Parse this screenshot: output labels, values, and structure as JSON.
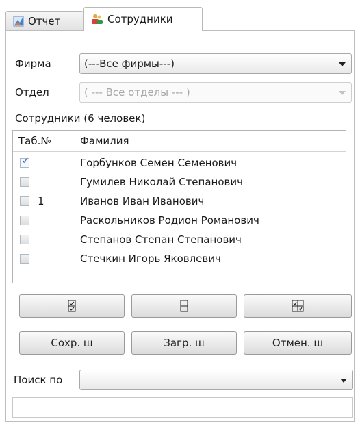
{
  "tabs": [
    {
      "label": "Отчет",
      "icon": "chart-icon"
    },
    {
      "label": "Сотрудники",
      "icon": "people-icon"
    }
  ],
  "filters": {
    "firm_label": "Фирма",
    "firm_value": "(---Все фирмы---)",
    "dept_label": "Отдел",
    "dept_value": "( --- Все отделы --- )"
  },
  "employees": {
    "title": "Сотрудники (6 человек)",
    "columns": [
      "Таб.№",
      "Фамилия"
    ],
    "rows": [
      {
        "checked": true,
        "tab_no": "",
        "name": "Горбунков Семен Семенович"
      },
      {
        "checked": false,
        "tab_no": "",
        "name": "Гумилев Николай Степанович"
      },
      {
        "checked": false,
        "tab_no": "1",
        "name": "Иванов Иван Иванович"
      },
      {
        "checked": false,
        "tab_no": "",
        "name": "Раскольников Родион Романович"
      },
      {
        "checked": false,
        "tab_no": "",
        "name": "Степанов Степан Степанович"
      },
      {
        "checked": false,
        "tab_no": "",
        "name": "Стечкин Игорь Яковлевич"
      }
    ]
  },
  "buttons": {
    "select_all_icon": "check-all-icon",
    "clear_all_icon": "uncheck-all-icon",
    "invert_icon": "invert-selection-icon",
    "save_template": "Сохр. ш",
    "load_template": "Загр. ш",
    "cancel_template": "Отмен. ш"
  },
  "search": {
    "label": "Поиск по",
    "value": "",
    "text": ""
  },
  "colors": {
    "check": "#1b5fb7",
    "border": "#b5b5b5"
  }
}
